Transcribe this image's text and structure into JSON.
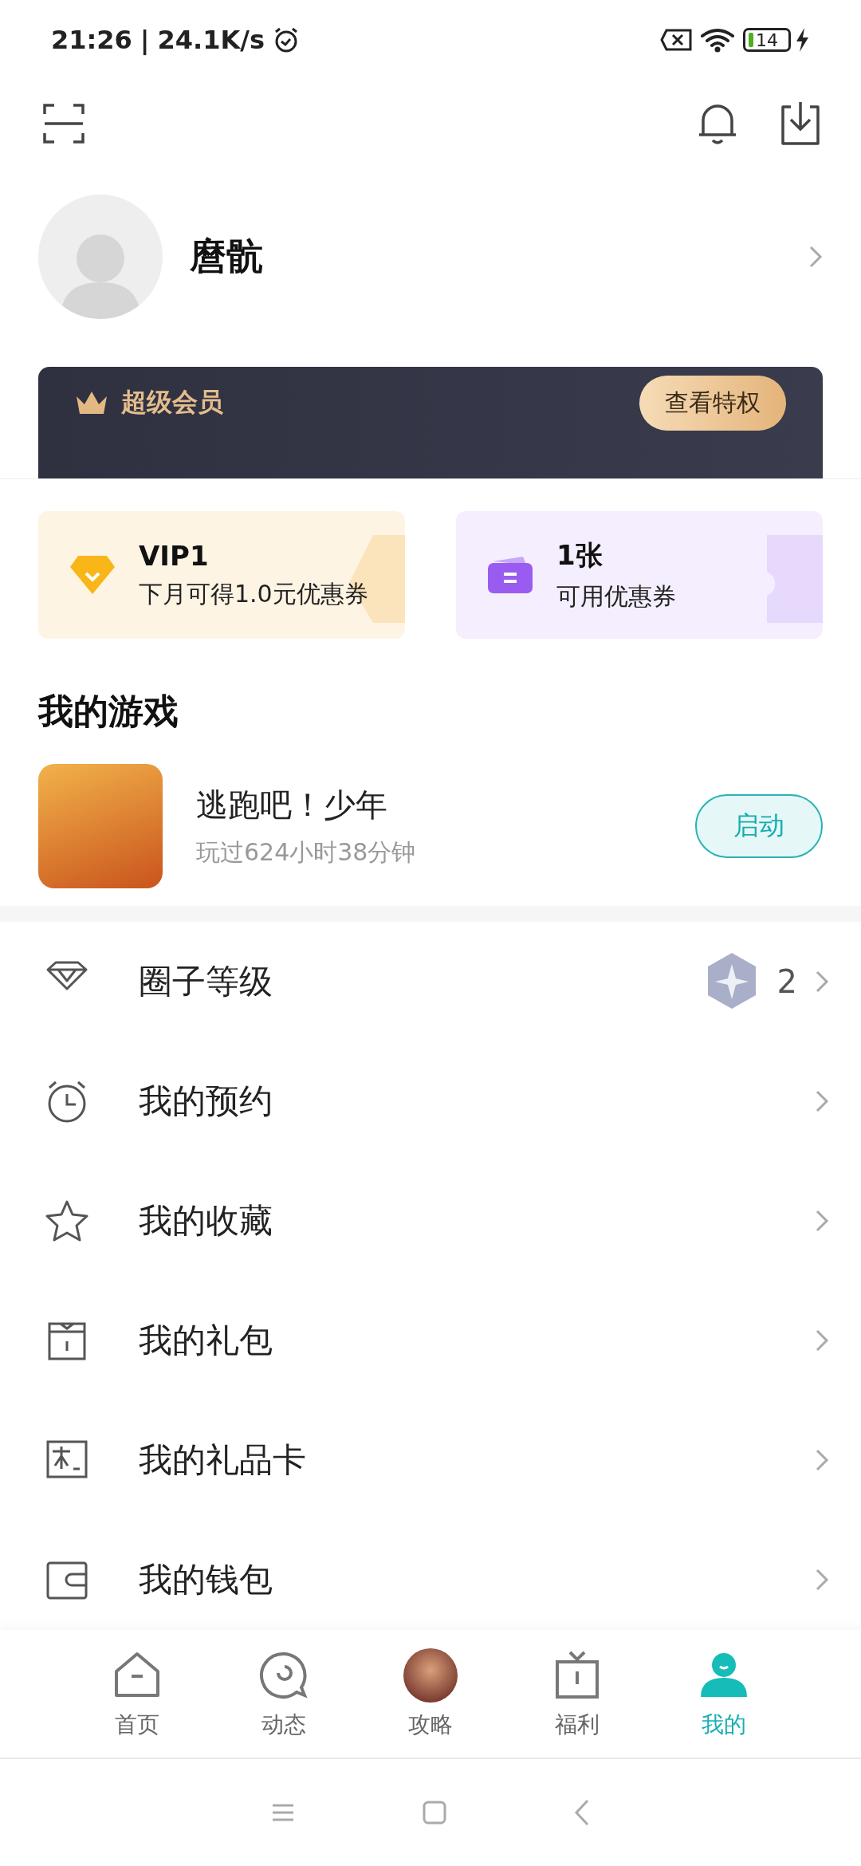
{
  "status_bar": {
    "time": "21:26",
    "separator": "|",
    "speed": "24.1K/s",
    "battery": "14"
  },
  "profile": {
    "name": "麿骯"
  },
  "vip_banner": {
    "title": "超级会员",
    "button": "查看特权"
  },
  "benefit_cards": [
    {
      "kind": "vip",
      "title": "VIP1",
      "subtitle": "下月可得1.0元优惠券"
    },
    {
      "kind": "coupon",
      "title": "1张",
      "subtitle": "可用优惠券"
    }
  ],
  "my_games": {
    "title": "我的游戏",
    "games": [
      {
        "name": "逃跑吧！少年",
        "playtime": "玩过624小时38分钟",
        "button": "启动"
      }
    ]
  },
  "menu": [
    {
      "kind": "level",
      "label": "圈子等级",
      "value": "2"
    },
    {
      "kind": "reservation",
      "label": "我的预约"
    },
    {
      "kind": "favorites",
      "label": "我的收藏"
    },
    {
      "kind": "gift",
      "label": "我的礼包"
    },
    {
      "kind": "giftcard",
      "label": "我的礼品卡"
    },
    {
      "kind": "wallet",
      "label": "我的钱包"
    }
  ],
  "bottom_nav": [
    {
      "kind": "home",
      "label": "首页",
      "selected": false
    },
    {
      "kind": "feed",
      "label": "动态",
      "selected": false
    },
    {
      "kind": "guide",
      "label": "攻略",
      "selected": false
    },
    {
      "kind": "welfare",
      "label": "福利",
      "selected": false
    },
    {
      "kind": "me",
      "label": "我的",
      "selected": true
    }
  ]
}
